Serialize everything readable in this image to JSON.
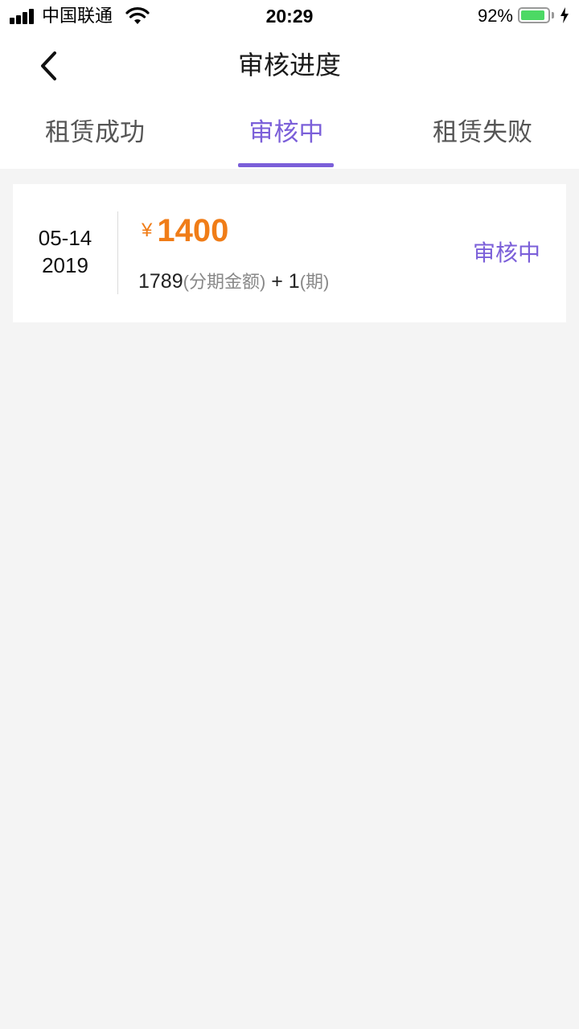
{
  "status_bar": {
    "carrier": "中国联通",
    "time": "20:29",
    "battery_percent": "92%",
    "battery_level": 0.92,
    "signal_bars": 4,
    "charging": true
  },
  "nav": {
    "title": "审核进度",
    "back_icon": "chevron-left-icon"
  },
  "tabs": [
    {
      "label": "租赁成功",
      "active": false
    },
    {
      "label": "审核中",
      "active": true
    },
    {
      "label": "租赁失败",
      "active": false
    }
  ],
  "colors": {
    "accent": "#7b5fd9",
    "amount": "#f07d18",
    "background": "#f4f4f4"
  },
  "records": [
    {
      "date_md": "05-14",
      "date_year": "2019",
      "currency": "¥",
      "amount": "1400",
      "installment_amount": "1789",
      "installment_amount_label": "(分期金额)",
      "plus": " + ",
      "periods": "1",
      "periods_label": "(期)",
      "status": "审核中"
    }
  ]
}
